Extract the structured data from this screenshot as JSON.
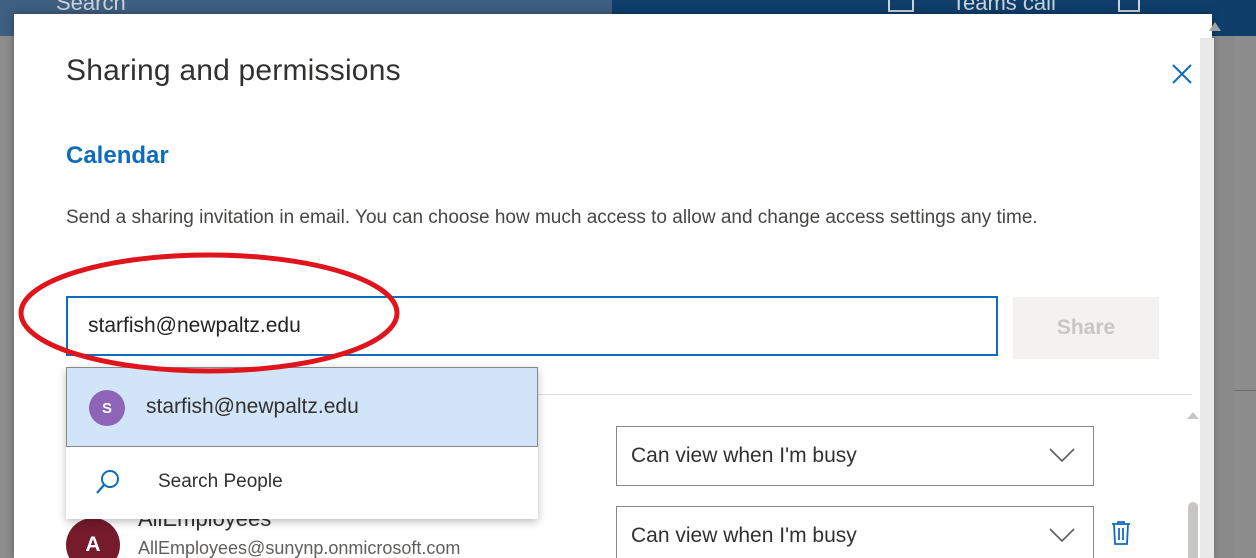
{
  "background": {
    "search_label": "Search",
    "teams_label": "Teams call"
  },
  "dialog": {
    "title": "Sharing and permissions",
    "section_heading": "Calendar",
    "description": "Send a sharing invitation in email. You can choose how much access to allow and change access settings any time.",
    "email_input": {
      "value": "starfish@newpaltz.edu",
      "placeholder": ""
    },
    "share_label": "Share",
    "suggestions": {
      "item": {
        "avatar_letter": "S",
        "email": "starfish@newpaltz.edu"
      },
      "search_people_label": "Search People"
    },
    "permissions": [
      {
        "label": "Can view when I'm busy"
      },
      {
        "name": "AllEmployees",
        "email": "AllEmployees@sunynp.onmicrosoft.com",
        "avatar_letter": "A",
        "label": "Can view when I'm busy"
      }
    ]
  },
  "colors": {
    "accent": "#0f6cbd",
    "annotation": "#e0141c",
    "avatar_s": "#8e64b9",
    "avatar_a": "#751b2b",
    "suggestion_highlight": "#d2e4f7"
  }
}
